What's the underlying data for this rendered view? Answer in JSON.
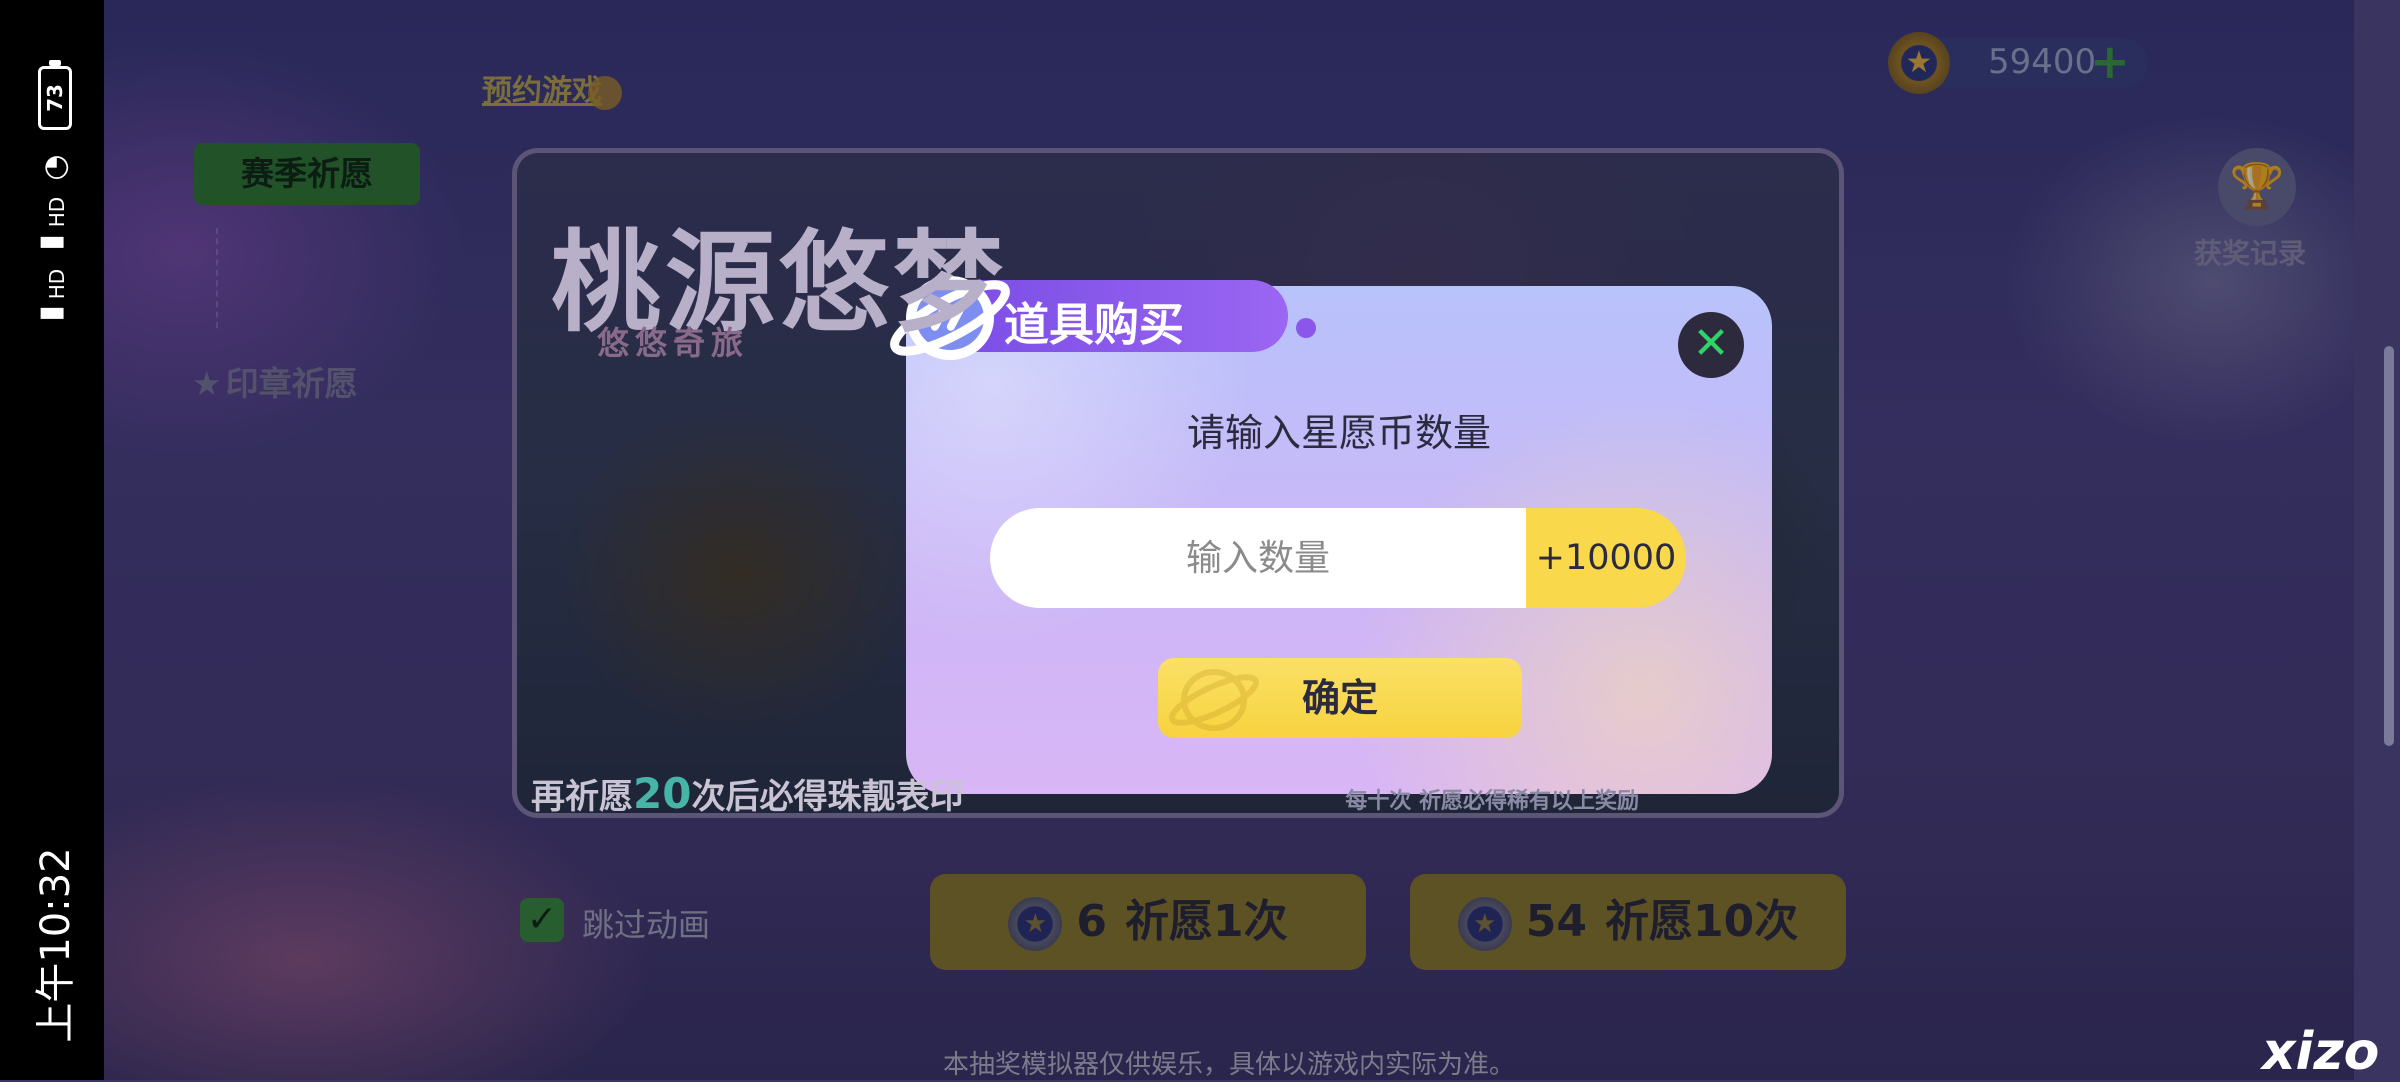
{
  "status_bar": {
    "time": "上午10:32",
    "battery": "73",
    "signal_label": "HD"
  },
  "top": {
    "reserve_link": "预约游戏",
    "coin_balance": "59400",
    "coin_plus": "+"
  },
  "sidebar": {
    "items": [
      {
        "label": "赛季祈愿",
        "active": true
      },
      {
        "label": "印章祈愿",
        "active": false
      }
    ]
  },
  "banner": {
    "title": "桃源悠梦",
    "subtitle": "悠悠奇旅",
    "footer_prefix": "再祈愿",
    "footer_count": "20",
    "footer_suffix": "次后必得珠靓表印",
    "right_note": "每十次 祈愿必得稀有以上奖励"
  },
  "records": {
    "label": "获奖记录"
  },
  "skip": {
    "label": "跳过动画",
    "checked": true
  },
  "draw_buttons": [
    {
      "cost": "6",
      "label": "祈愿1次"
    },
    {
      "cost": "54",
      "label": "祈愿10次"
    }
  ],
  "disclaimer": "本抽奖模拟器仅供娱乐，具体以游戏内实际为准。",
  "modal": {
    "title": "道具购买",
    "prompt": "请输入星愿币数量",
    "input_placeholder": "输入数量",
    "input_value": "",
    "plus_button": "+10000",
    "confirm_button": "确定"
  },
  "watermark": "xizo",
  "colors": {
    "accent_yellow": "#f9d84b",
    "modal_purple": "#9a66f2",
    "close_green": "#2fd36a",
    "active_tab_green": "#2f7a2e"
  }
}
